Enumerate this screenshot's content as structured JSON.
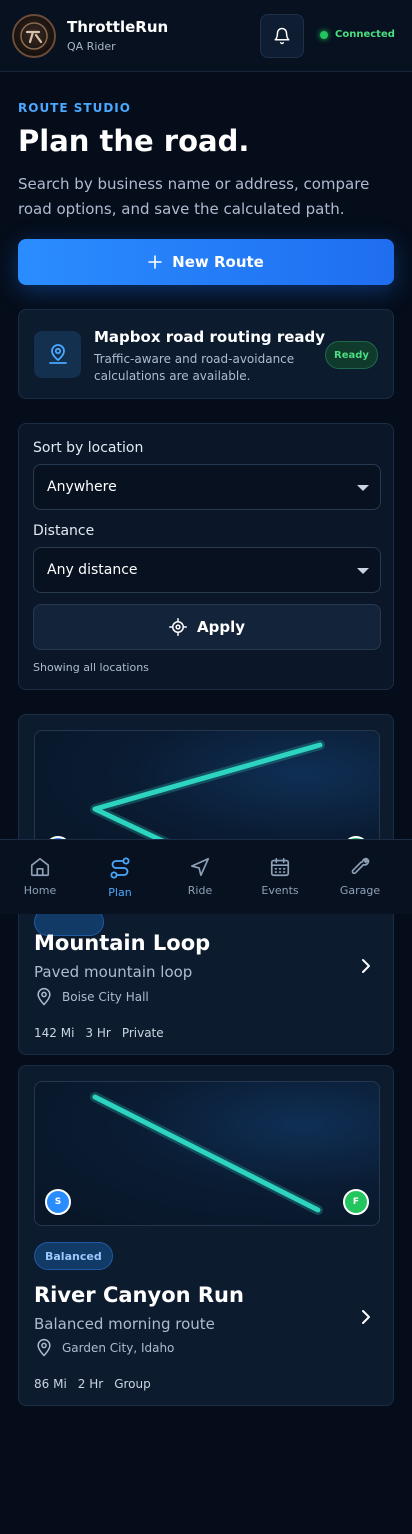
{
  "header": {
    "app_name": "ThrottleRun",
    "user_role": "QA Rider",
    "connection_status": "Connected",
    "connection_color": "#22c55e"
  },
  "hero": {
    "eyebrow": "ROUTE STUDIO",
    "title": "Plan the road.",
    "description": "Search by business name or address, compare road options, and save the calculated path.",
    "new_route_label": "New Route"
  },
  "routing_status": {
    "title": "Mapbox road routing ready",
    "text": "Traffic-aware and road-avoidance calculations are available.",
    "badge": "Ready"
  },
  "filters": {
    "sort_label": "Sort by location",
    "sort_value": "Anywhere",
    "distance_label": "Distance",
    "distance_value": "Any distance",
    "apply_label": "Apply",
    "showing_text": "Showing all locations"
  },
  "routes": [
    {
      "name": "Mountain Loop",
      "description": "Paved mountain loop",
      "location": "Boise City Hall",
      "miles": "142 Mi",
      "duration": "3 Hr",
      "visibility": "Private"
    },
    {
      "tag": "Balanced",
      "name": "River Canyon Run",
      "description": "Balanced morning route",
      "location": "Garden City, Idaho",
      "miles": "86 Mi",
      "duration": "2 Hr",
      "visibility": "Group",
      "start_pin": "S",
      "finish_pin": "F"
    }
  ],
  "nav": {
    "items": [
      {
        "label": "Home",
        "icon": "home-icon"
      },
      {
        "label": "Plan",
        "icon": "route-icon",
        "active": true
      },
      {
        "label": "Ride",
        "icon": "navigation-icon"
      },
      {
        "label": "Events",
        "icon": "calendar-icon"
      },
      {
        "label": "Garage",
        "icon": "wrench-icon"
      }
    ]
  },
  "colors": {
    "accent": "#2a8dff",
    "route_line": "#2dd4bf",
    "start_pin": "#2a8dff",
    "finish_pin": "#22c55e"
  }
}
